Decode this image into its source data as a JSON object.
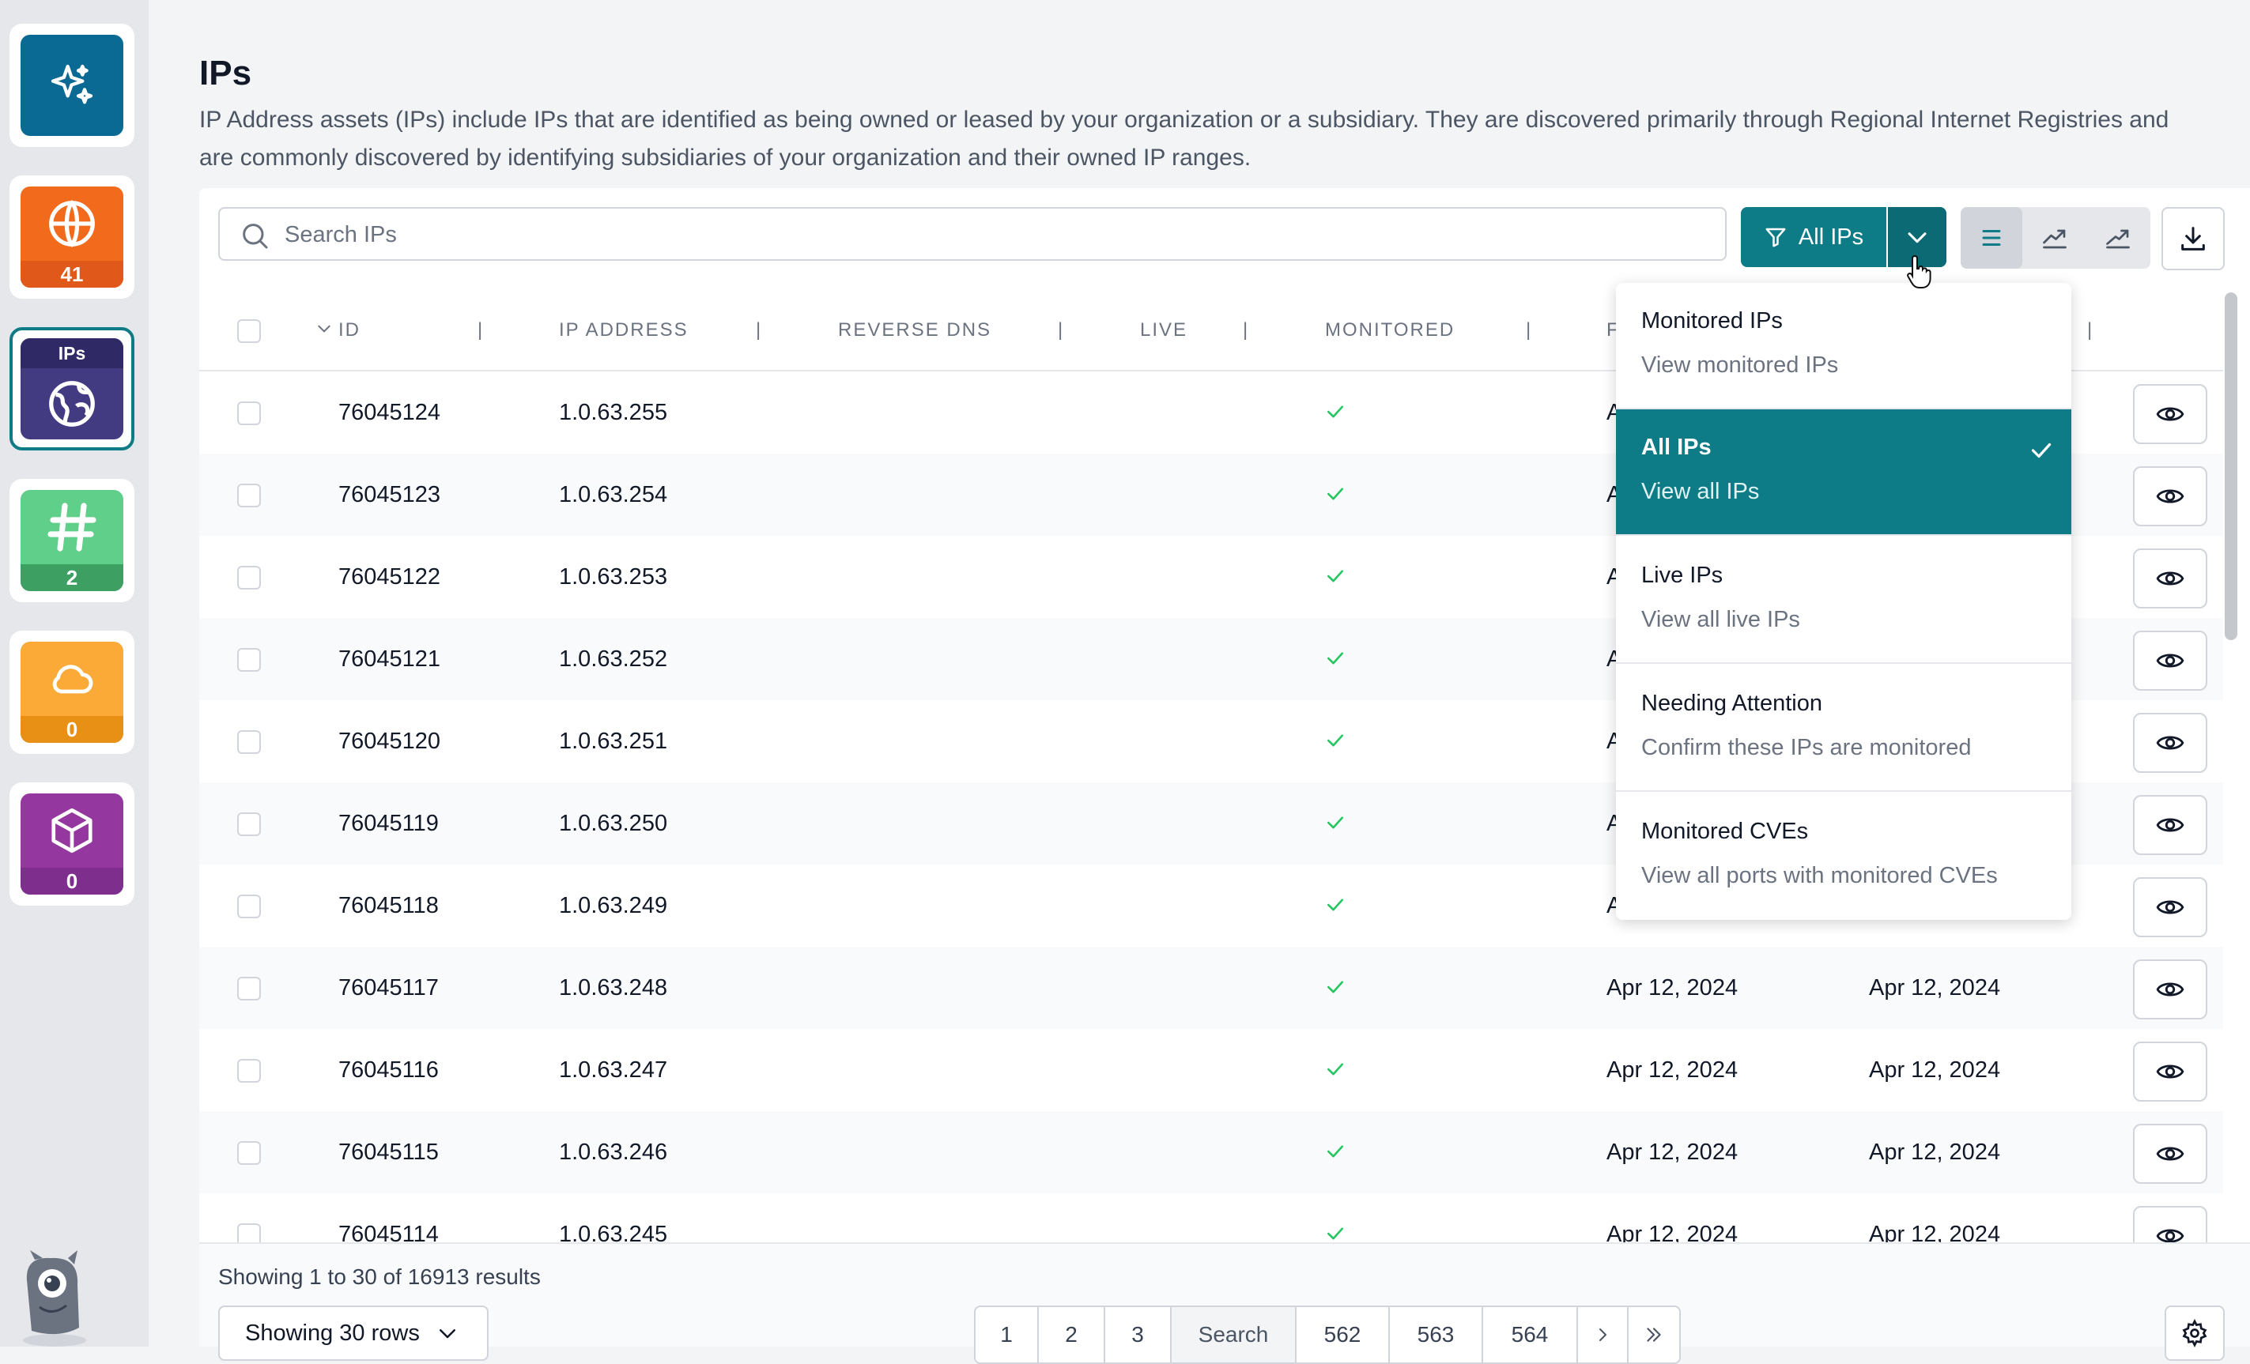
{
  "sidebar": {
    "items": [
      {
        "name": "sparkles",
        "count": "",
        "color": "#0a6a94",
        "label": ""
      },
      {
        "name": "domains-globe",
        "count": "41",
        "color": "#f26b1d",
        "label": ""
      },
      {
        "name": "ips",
        "count": "",
        "color": "#433b82",
        "label": "IPs"
      },
      {
        "name": "hashtag",
        "count": "2",
        "color": "#3e9f63",
        "label": ""
      },
      {
        "name": "cloud",
        "count": "0",
        "color": "#f59e0b",
        "label": ""
      },
      {
        "name": "cube",
        "count": "0",
        "color": "#7e2f8e",
        "label": ""
      }
    ]
  },
  "page": {
    "title": "IPs",
    "description": "IP Address assets (IPs) include IPs that are identified as being owned or leased by your organization or a subsidiary. They are discovered primarily through Regional Internet Registries and are commonly discovered by identifying subsidiaries of your organization and their owned IP ranges."
  },
  "toolbar": {
    "search_placeholder": "Search IPs",
    "filter_label": "All IPs"
  },
  "table": {
    "headers": [
      "ID",
      "IP ADDRESS",
      "REVERSE DNS",
      "LIVE",
      "MONITORED",
      "F"
    ],
    "rows": [
      {
        "id": "76045124",
        "ip": "1.0.63.255",
        "first_seen": "A",
        "last_seen": ""
      },
      {
        "id": "76045123",
        "ip": "1.0.63.254",
        "first_seen": "A",
        "last_seen": ""
      },
      {
        "id": "76045122",
        "ip": "1.0.63.253",
        "first_seen": "A",
        "last_seen": ""
      },
      {
        "id": "76045121",
        "ip": "1.0.63.252",
        "first_seen": "A",
        "last_seen": ""
      },
      {
        "id": "76045120",
        "ip": "1.0.63.251",
        "first_seen": "A",
        "last_seen": ""
      },
      {
        "id": "76045119",
        "ip": "1.0.63.250",
        "first_seen": "A",
        "last_seen": ""
      },
      {
        "id": "76045118",
        "ip": "1.0.63.249",
        "first_seen": "A",
        "last_seen": ""
      },
      {
        "id": "76045117",
        "ip": "1.0.63.248",
        "first_seen": "Apr 12, 2024",
        "last_seen": "Apr 12, 2024"
      },
      {
        "id": "76045116",
        "ip": "1.0.63.247",
        "first_seen": "Apr 12, 2024",
        "last_seen": "Apr 12, 2024"
      },
      {
        "id": "76045115",
        "ip": "1.0.63.246",
        "first_seen": "Apr 12, 2024",
        "last_seen": "Apr 12, 2024"
      },
      {
        "id": "76045114",
        "ip": "1.0.63.245",
        "first_seen": "Apr 12, 2024",
        "last_seen": "Apr 12, 2024"
      }
    ]
  },
  "footer": {
    "results_text": "Showing 1 to 30 of 16913 results",
    "rows_select": "Showing 30 rows",
    "pages": [
      "1",
      "2",
      "3",
      "Search",
      "562",
      "563",
      "564"
    ]
  },
  "dropdown": {
    "items": [
      {
        "label": "Monitored IPs",
        "sub": "View monitored IPs",
        "selected": false
      },
      {
        "label": "All IPs",
        "sub": "View all IPs",
        "selected": true
      },
      {
        "label": "Live IPs",
        "sub": "View all live IPs",
        "selected": false
      },
      {
        "label": "Needing Attention",
        "sub": "Confirm these IPs are monitored",
        "selected": false
      },
      {
        "label": "Monitored CVEs",
        "sub": "View all ports with monitored CVEs",
        "selected": false
      }
    ]
  },
  "colors": {
    "accent": "#0e7c86",
    "check": "#22c55e"
  }
}
